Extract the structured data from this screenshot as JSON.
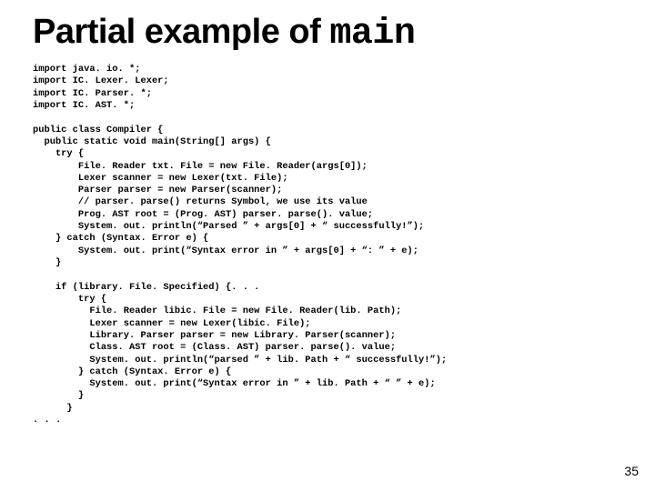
{
  "title": {
    "pre": "Partial example of ",
    "mono": "main"
  },
  "code": "import java. io. *;\nimport IC. Lexer. Lexer;\nimport IC. Parser. *;\nimport IC. AST. *;\n\npublic class Compiler {\n  public static void main(String[] args) {\n    try {\n        File. Reader txt. File = new File. Reader(args[0]);\n        Lexer scanner = new Lexer(txt. File);\n        Parser parser = new Parser(scanner);\n        // parser. parse() returns Symbol, we use its value\n        Prog. AST root = (Prog. AST) parser. parse(). value;\n        System. out. println(“Parsed ” + args[0] + “ successfully!”);\n    } catch (Syntax. Error e) {\n        System. out. print(“Syntax error in ” + args[0] + “: ” + e);\n    }\n\n    if (library. File. Specified) {. . .\n        try {\n          File. Reader libic. File = new File. Reader(lib. Path);\n          Lexer scanner = new Lexer(libic. File);\n          Library. Parser parser = new Library. Parser(scanner);\n          Class. AST root = (Class. AST) parser. parse(). value;\n          System. out. println(“parsed ” + lib. Path + “ successfully!”);\n        } catch (Syntax. Error e) {\n          System. out. print(“Syntax error in ” + lib. Path + “ ” + e);\n        }\n      }\n. . .",
  "slide_number": "35"
}
